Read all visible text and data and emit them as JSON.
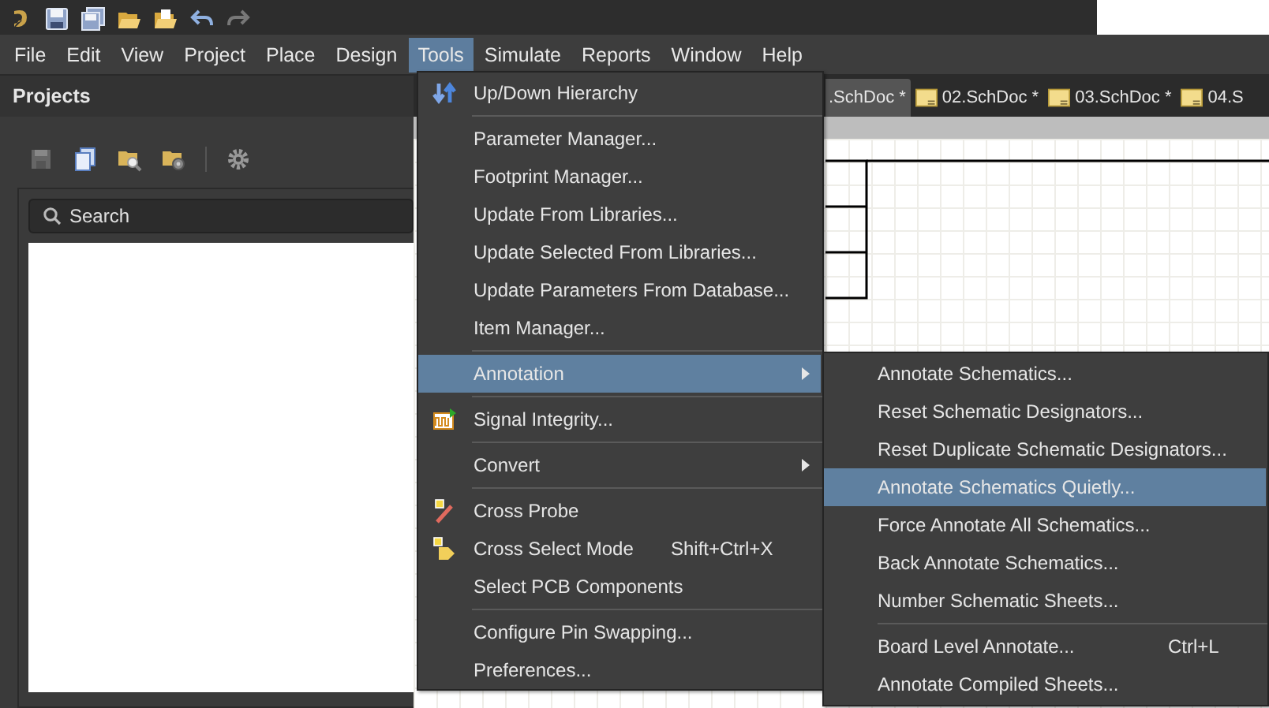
{
  "menubar": [
    {
      "label": "File",
      "selected": false
    },
    {
      "label": "Edit",
      "selected": false
    },
    {
      "label": "View",
      "selected": false
    },
    {
      "label": "Project",
      "selected": false
    },
    {
      "label": "Place",
      "selected": false
    },
    {
      "label": "Design",
      "selected": false
    },
    {
      "label": "Tools",
      "selected": true
    },
    {
      "label": "Simulate",
      "selected": false
    },
    {
      "label": "Reports",
      "selected": false
    },
    {
      "label": "Window",
      "selected": false
    },
    {
      "label": "Help",
      "selected": false
    }
  ],
  "projects_panel": {
    "title": "Projects",
    "search": {
      "placeholder": "Search"
    }
  },
  "document_tabs": [
    {
      "label": ".SchDoc *",
      "selected": true
    },
    {
      "label": "02.SchDoc *",
      "selected": false
    },
    {
      "label": "03.SchDoc *",
      "selected": false
    },
    {
      "label": "04.S",
      "selected": false
    }
  ],
  "tools_menu": [
    {
      "kind": "item",
      "label": "Up/Down Hierarchy",
      "selected": false
    },
    {
      "kind": "separator"
    },
    {
      "kind": "item",
      "label": "Parameter Manager...",
      "selected": false
    },
    {
      "kind": "item",
      "label": "Footprint Manager...",
      "selected": false
    },
    {
      "kind": "item",
      "label": "Update From Libraries...",
      "selected": false
    },
    {
      "kind": "item",
      "label": "Update Selected From Libraries...",
      "selected": false
    },
    {
      "kind": "item",
      "label": "Update Parameters From Database...",
      "selected": false
    },
    {
      "kind": "item",
      "label": "Item Manager...",
      "selected": false
    },
    {
      "kind": "separator"
    },
    {
      "kind": "item",
      "label": "Annotation",
      "submenu": true,
      "selected": true
    },
    {
      "kind": "separator"
    },
    {
      "kind": "item",
      "label": "Signal Integrity...",
      "selected": false
    },
    {
      "kind": "separator"
    },
    {
      "kind": "item",
      "label": "Convert",
      "submenu": true,
      "selected": false
    },
    {
      "kind": "separator"
    },
    {
      "kind": "item",
      "label": "Cross Probe",
      "selected": false
    },
    {
      "kind": "item",
      "label": "Cross Select Mode",
      "shortcut": "Shift+Ctrl+X",
      "selected": false
    },
    {
      "kind": "item",
      "label": "Select PCB Components",
      "selected": false
    },
    {
      "kind": "separator"
    },
    {
      "kind": "item",
      "label": "Configure Pin Swapping...",
      "selected": false
    },
    {
      "kind": "item",
      "label": "Preferences...",
      "selected": false
    }
  ],
  "annotation_submenu": [
    {
      "kind": "item",
      "label": "Annotate Schematics...",
      "selected": false
    },
    {
      "kind": "item",
      "label": "Reset Schematic Designators...",
      "selected": false
    },
    {
      "kind": "item",
      "label": "Reset Duplicate Schematic Designators...",
      "selected": false
    },
    {
      "kind": "item",
      "label": "Annotate Schematics Quietly...",
      "selected": true
    },
    {
      "kind": "item",
      "label": "Force Annotate All Schematics...",
      "selected": false
    },
    {
      "kind": "item",
      "label": "Back Annotate Schematics...",
      "selected": false
    },
    {
      "kind": "item",
      "label": "Number Schematic Sheets...",
      "selected": false
    },
    {
      "kind": "separator"
    },
    {
      "kind": "item",
      "label": "Board Level Annotate...",
      "shortcut": "Ctrl+L",
      "selected": false
    },
    {
      "kind": "item",
      "label": "Annotate Compiled Sheets...",
      "selected": false
    }
  ]
}
